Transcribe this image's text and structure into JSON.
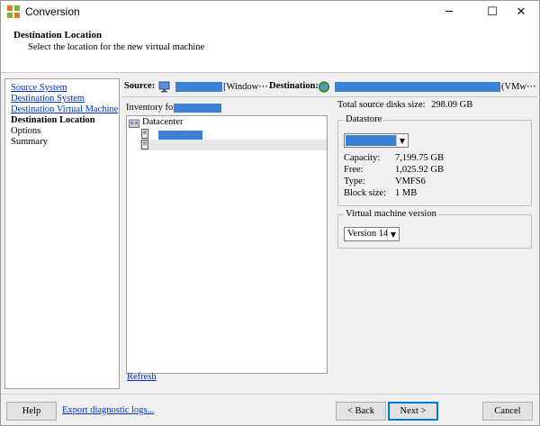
{
  "window": {
    "title": "Conversion",
    "minimize_glyph": "─",
    "maximize_glyph": "☐",
    "close_glyph": "✕",
    "icon": "conversion-app-icon"
  },
  "header": {
    "title": "Destination Location",
    "subtitle": "Select the location for the new virtual machine"
  },
  "sidebar": {
    "items": [
      {
        "label": "Source System",
        "state": "link"
      },
      {
        "label": "Destination System",
        "state": "link"
      },
      {
        "label": "Destination Virtual Machine",
        "state": "link"
      },
      {
        "label": "Destination Location",
        "state": "current"
      },
      {
        "label": "Options",
        "state": "plain"
      },
      {
        "label": "Summary",
        "state": "plain"
      }
    ]
  },
  "main": {
    "source_label": "Source:",
    "source_suffix": "[Window⋯",
    "destination_label": "Destination:",
    "destination_suffix": "(VMw⋯",
    "inventory_label": "Inventory for:",
    "tree": {
      "root": "Datacenter"
    },
    "refresh_label": "Refresh",
    "total_disk_label": "Total source disks size:",
    "total_disk_value": "298.09 GB",
    "datastore": {
      "legend": "Datastore",
      "capacity_label": "Capacity:",
      "capacity_value": "7,199.75 GB",
      "free_label": "Free:",
      "free_value": "1,025.92 GB",
      "type_label": "Type:",
      "type_value": "VMFS6",
      "block_label": "Block size:",
      "block_value": "1 MB"
    },
    "vm_version": {
      "legend": "Virtual machine version",
      "selected": "Version 14"
    }
  },
  "footer": {
    "help": "Help",
    "export": "Export diagnostic logs...",
    "back": "Back",
    "next": "Next",
    "cancel": "Cancel"
  },
  "colors": {
    "redaction": "#3b82d6",
    "link": "#0033cc",
    "default_button_border": "#0078d7"
  }
}
